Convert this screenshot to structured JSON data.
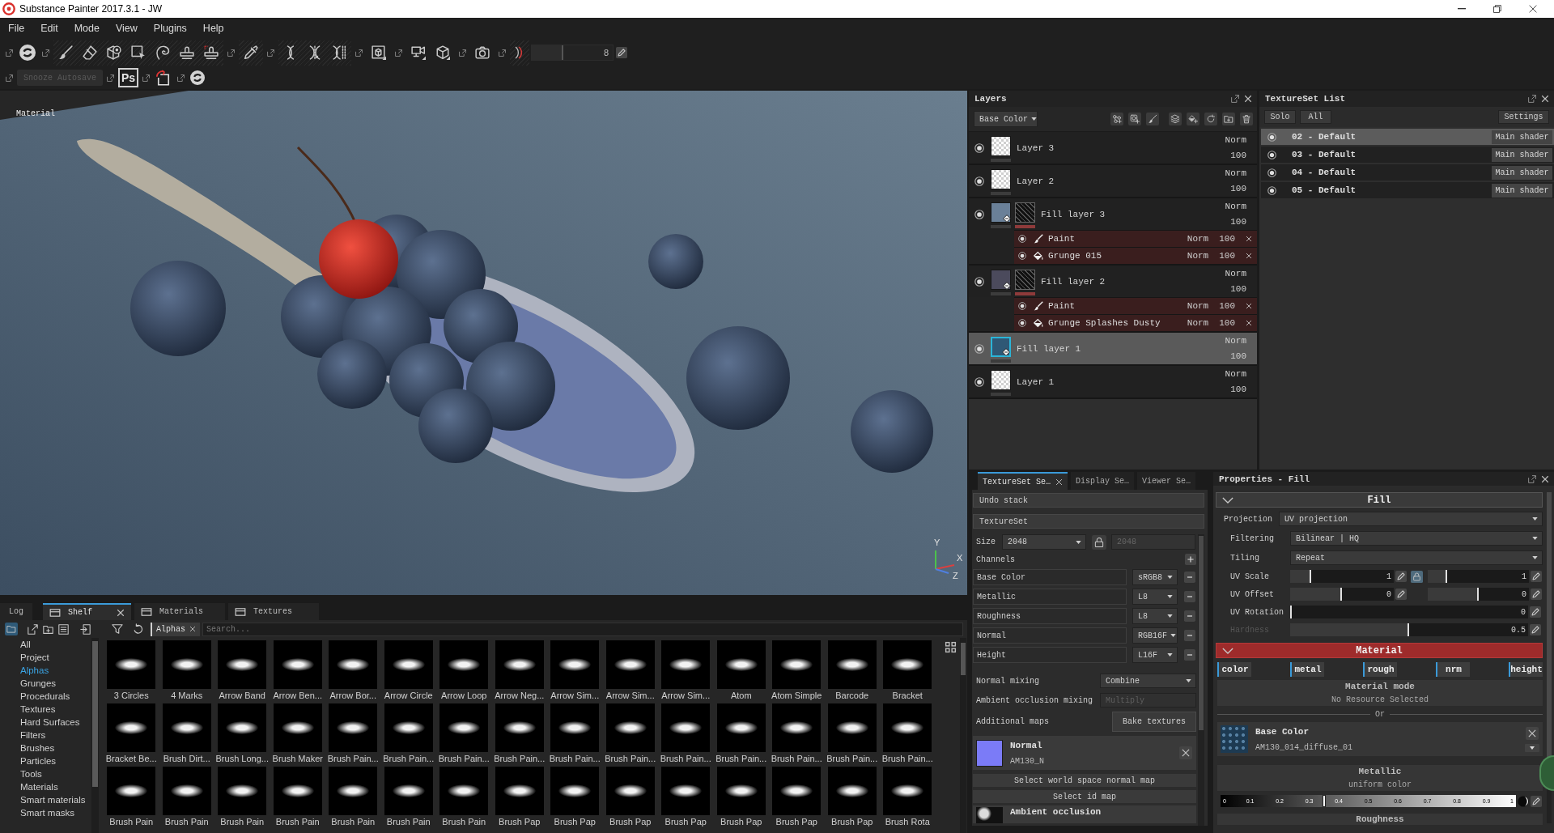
{
  "window": {
    "title": "Substance Painter 2017.3.1 - JW"
  },
  "menu": [
    "File",
    "Edit",
    "Mode",
    "View",
    "Plugins",
    "Help"
  ],
  "toolbar": {
    "brush_size": {
      "value": "8",
      "level": 0.39
    },
    "autosave_button": {
      "label": "Snooze Autosave",
      "disabled": true
    },
    "photoshop_badge": "Ps"
  },
  "viewport": {
    "label": "Material",
    "axes": [
      "Y",
      "X",
      "Z"
    ]
  },
  "layers_panel": {
    "title": "Layers",
    "channel": "Base Color",
    "layers": [
      {
        "name": "Layer 3",
        "kind": "paint",
        "blend": "Norm",
        "opacity": "100",
        "visible": true,
        "selected": false,
        "mask": false
      },
      {
        "name": "Layer 2",
        "kind": "paint",
        "blend": "Norm",
        "opacity": "100",
        "visible": true,
        "selected": false,
        "mask": false
      },
      {
        "name": "Fill layer 3",
        "kind": "fill",
        "color": "#6a8098",
        "blend": "Norm",
        "opacity": "100",
        "visible": true,
        "selected": false,
        "mask": true,
        "children": [
          {
            "name": "Paint",
            "kind": "paint",
            "blend": "Norm",
            "opacity": "100",
            "visible": true
          },
          {
            "name": "Grunge 015",
            "kind": "fill",
            "blend": "Norm",
            "opacity": "100",
            "visible": true
          }
        ]
      },
      {
        "name": "Fill layer 2",
        "kind": "fill",
        "color": "#4b4a5c",
        "blend": "Norm",
        "opacity": "100",
        "visible": true,
        "selected": false,
        "mask": true,
        "children": [
          {
            "name": "Paint",
            "kind": "paint",
            "blend": "Norm",
            "opacity": "100",
            "visible": true
          },
          {
            "name": "Grunge Splashes Dusty",
            "kind": "fill",
            "blend": "Norm",
            "opacity": "100",
            "visible": true
          }
        ]
      },
      {
        "name": "Fill layer 1",
        "kind": "fill",
        "color": "#2f5875",
        "blend": "Norm",
        "opacity": "100",
        "visible": true,
        "selected": true,
        "mask": false
      },
      {
        "name": "Layer 1",
        "kind": "paint",
        "blend": "Norm",
        "opacity": "100",
        "visible": true,
        "selected": false,
        "mask": false
      }
    ]
  },
  "textureset_list": {
    "title": "TextureSet List",
    "filters": [
      "Solo",
      "All"
    ],
    "settings_button": "Settings",
    "sets": [
      {
        "name": "02 - Default",
        "shader": "Main shader",
        "visible": true,
        "selected": true
      },
      {
        "name": "03 - Default",
        "shader": "Main shader",
        "visible": true,
        "selected": false
      },
      {
        "name": "04 - Default",
        "shader": "Main shader",
        "visible": true,
        "selected": false
      },
      {
        "name": "05 - Default",
        "shader": "Main shader",
        "visible": true,
        "selected": false
      }
    ]
  },
  "textureset_settings": {
    "tabs": [
      {
        "label": "TextureSet Se…",
        "selected": true
      },
      {
        "label": "Display Se…",
        "selected": false
      },
      {
        "label": "Viewer Se…",
        "selected": false
      }
    ],
    "undo_stack": "Undo stack",
    "textureset": "TextureSet",
    "size": {
      "label": "Size",
      "value": "2048",
      "linked_value": "2048"
    },
    "channels": {
      "label": "Channels",
      "items": [
        {
          "name": "Base Color",
          "format": "sRGB8"
        },
        {
          "name": "Metallic",
          "format": "L8"
        },
        {
          "name": "Roughness",
          "format": "L8"
        },
        {
          "name": "Normal",
          "format": "RGB16F"
        },
        {
          "name": "Height",
          "format": "L16F"
        }
      ]
    },
    "mixing": [
      {
        "label": "Normal mixing",
        "value": "Combine",
        "disabled": false
      },
      {
        "label": "Ambient occlusion mixing",
        "value": "Multiply",
        "disabled": true
      }
    ],
    "additional_maps": {
      "label": "Additional maps",
      "bake_button": "Bake textures",
      "entries": [
        {
          "kind": "swatch",
          "title": "Normal",
          "file": "AM130_N"
        },
        {
          "kind": "button",
          "label": "Select world space normal map"
        },
        {
          "kind": "button",
          "label": "Select id map"
        },
        {
          "kind": "texture",
          "title": "Ambient occlusion"
        }
      ]
    }
  },
  "properties": {
    "title": "Properties - Fill",
    "fill": {
      "title": "Fill",
      "expanded": true,
      "fields": [
        {
          "label": "Projection",
          "kind": "dropdown",
          "value": "UV projection",
          "disabled": false
        },
        {
          "label": "Filtering",
          "kind": "dropdown",
          "value": "Bilinear | HQ",
          "disabled": false
        },
        {
          "label": "Tiling",
          "kind": "dropdown",
          "value": "Repeat",
          "disabled": false
        },
        {
          "label": "UV Scale",
          "kind": "locked_pair",
          "disabled": false,
          "sliders": [
            {
              "value": "1",
              "level": 0.2
            },
            {
              "value": "1",
              "level": 0.19
            }
          ]
        },
        {
          "label": "UV Offset",
          "kind": "pair",
          "disabled": false,
          "sliders": [
            {
              "value": "0",
              "level": 0.5
            },
            {
              "value": "0",
              "level": 0.5
            }
          ]
        },
        {
          "label": "UV Rotation",
          "kind": "slider",
          "disabled": false,
          "sliders": [
            {
              "value": "0",
              "level": 0
            }
          ]
        },
        {
          "label": "Hardness",
          "kind": "slider",
          "disabled": true,
          "sliders": [
            {
              "value": "0.5",
              "level": 0.5
            }
          ]
        }
      ]
    },
    "material": {
      "title": "Material",
      "expanded": true,
      "channels": [
        {
          "label": "color",
          "on": true
        },
        {
          "label": "metal",
          "on": true
        },
        {
          "label": "rough",
          "on": true
        },
        {
          "label": "nrm",
          "on": true
        },
        {
          "label": "height",
          "on": true
        }
      ],
      "mode": {
        "title": "Material mode",
        "value": "No Resource Selected"
      },
      "separator": "Or",
      "base_color": {
        "title": "Base Color",
        "file": "AM130_014_diffuse_01"
      },
      "metallic": {
        "title": "Metallic",
        "mode": "uniform color",
        "level": 0.35,
        "ticks": [
          "0",
          "0.1",
          "0.2",
          "0.3",
          "0.4",
          "0.5",
          "0.6",
          "0.7",
          "0.8",
          "0.9",
          "1"
        ]
      },
      "roughness": {
        "title": "Roughness"
      }
    }
  },
  "shelf": {
    "tabs": [
      {
        "label": "Log",
        "kind": "text",
        "selected": false
      },
      {
        "label": "Shelf",
        "kind": "dock",
        "selected": true
      },
      {
        "label": "Materials",
        "kind": "dock",
        "selected": false
      },
      {
        "label": "Textures",
        "kind": "dock",
        "selected": false
      }
    ],
    "filter_tag": "Alphas",
    "search_placeholder": "Search...",
    "categories": [
      {
        "label": "All",
        "selected": false
      },
      {
        "label": "Project",
        "selected": false
      },
      {
        "label": "Alphas",
        "selected": true
      },
      {
        "label": "Grunges",
        "selected": false
      },
      {
        "label": "Procedurals",
        "selected": false
      },
      {
        "label": "Textures",
        "selected": false
      },
      {
        "label": "Hard Surfaces",
        "selected": false
      },
      {
        "label": "Filters",
        "selected": false
      },
      {
        "label": "Brushes",
        "selected": false
      },
      {
        "label": "Particles",
        "selected": false
      },
      {
        "label": "Tools",
        "selected": false
      },
      {
        "label": "Materials",
        "selected": false
      },
      {
        "label": "Smart materials",
        "selected": false
      },
      {
        "label": "Smart masks",
        "selected": false
      }
    ],
    "items": [
      "3 Circles",
      "4 Marks",
      "Arrow Band",
      "Arrow Ben...",
      "Arrow Bor...",
      "Arrow Circle",
      "Arrow Loop",
      "Arrow Neg...",
      "Arrow Sim...",
      "Arrow Sim...",
      "Arrow Sim...",
      "Atom",
      "Atom Simple",
      "Barcode",
      "Bracket",
      "Bracket Be...",
      "Brush Dirt...",
      "Brush Long...",
      "Brush Maker",
      "Brush Pain...",
      "Brush Pain...",
      "Brush Pain...",
      "Brush Pain...",
      "Brush Pain...",
      "Brush Pain...",
      "Brush Pain...",
      "Brush Pain...",
      "Brush Pain...",
      "Brush Pain...",
      "Brush Pain...",
      "Brush Pain",
      "Brush Pain",
      "Brush Pain",
      "Brush Pain",
      "Brush Pain",
      "Brush Pain",
      "Brush Pain",
      "Brush Pap",
      "Brush Pap",
      "Brush Pap",
      "Brush Pap",
      "Brush Pap",
      "Brush Pap",
      "Brush Pap",
      "Brush Rota"
    ]
  }
}
